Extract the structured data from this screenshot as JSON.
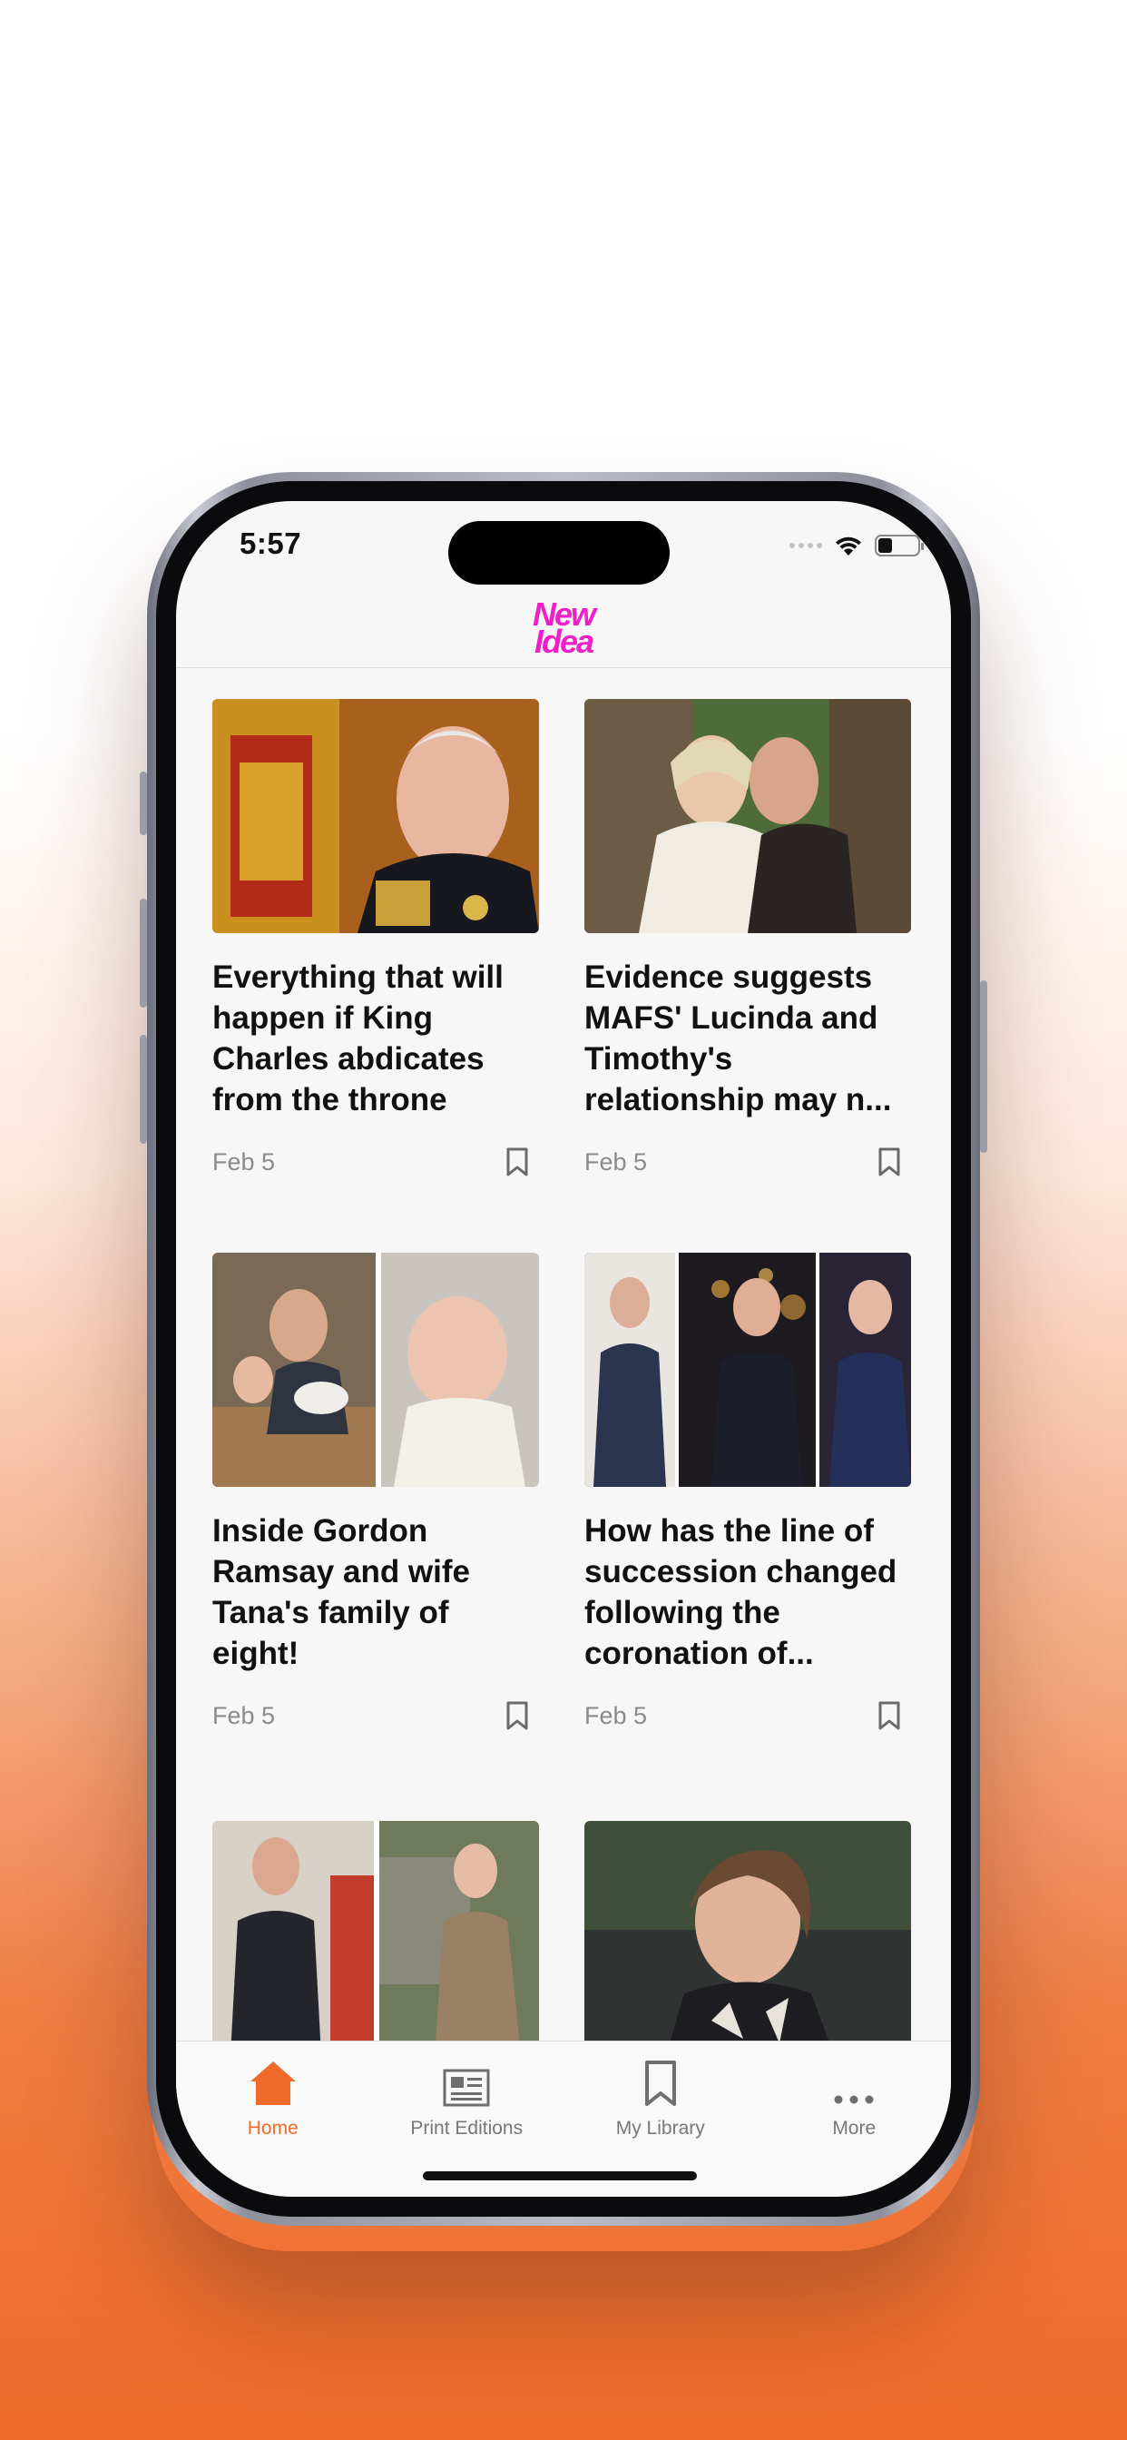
{
  "status": {
    "time": "5:57"
  },
  "app": {
    "logo_line1": "New",
    "logo_line2": "Idea",
    "logo_color": "#f01fc9",
    "accent": "#ee6a2a"
  },
  "articles": [
    {
      "title": "Everything that will happen if King Charles abdicates from the throne",
      "date": "Feb 5",
      "image": "king-charles-portrait"
    },
    {
      "title": "Evidence suggests MAFS' Lucinda and Timothy's relationship may n...",
      "date": "Feb 5",
      "image": "couple-wedding-photo"
    },
    {
      "title": "Inside Gordon Ramsay and wife Tana's family of eight!",
      "date": "Feb 5",
      "image": "ramsay-family-collage"
    },
    {
      "title": "How has the line of succession changed following the coronation of...",
      "date": "Feb 5",
      "image": "royals-collage"
    },
    {
      "title": "",
      "date": "",
      "image": "harry-charles-collage"
    },
    {
      "title": "",
      "date": "",
      "image": "woman-portrait"
    }
  ],
  "tabbar": {
    "items": [
      {
        "label": "Home",
        "icon": "home-icon",
        "active": true
      },
      {
        "label": "Print Editions",
        "icon": "newspaper-icon",
        "active": false
      },
      {
        "label": "My Library",
        "icon": "bookmark-icon",
        "active": false
      },
      {
        "label": "More",
        "icon": "more-dots-icon",
        "active": false
      }
    ]
  }
}
